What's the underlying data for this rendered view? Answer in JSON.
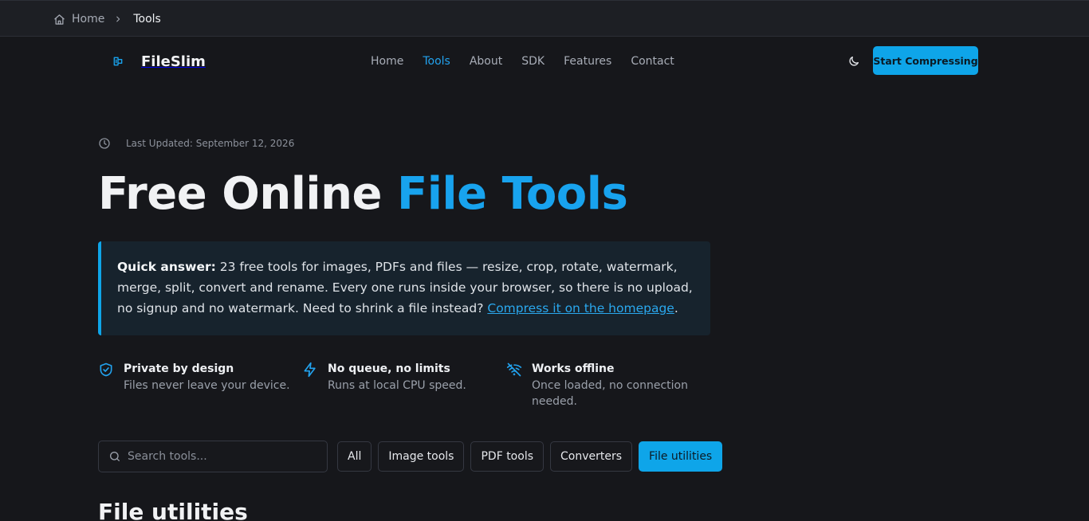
{
  "breadcrumb": {
    "home": "Home",
    "current": "Tools"
  },
  "brand": {
    "name": "FileSlim",
    "accent": "#0ea5e9"
  },
  "nav": {
    "items": [
      {
        "label": "Home"
      },
      {
        "label": "Tools",
        "active": true
      },
      {
        "label": "About"
      },
      {
        "label": "SDK"
      },
      {
        "label": "Features"
      },
      {
        "label": "Contact"
      }
    ],
    "cta": "Start Compressing"
  },
  "page": {
    "updated": "Last Updated: September 12, 2026",
    "title_main": "Free Online ",
    "title_accent": "File Tools",
    "answer": {
      "lead": "Quick answer:",
      "text": " 23 free tools for images, PDFs and files — resize, crop, rotate, watermark, merge, split, convert and rename. Every one runs inside your browser, so there is no upload, no signup and no watermark. Need to shrink a file instead? ",
      "link": "Compress it on the homepage",
      "tail": "."
    },
    "features": [
      {
        "icon": "shield-check-icon",
        "title": "Private by design",
        "desc": "Files never leave your device."
      },
      {
        "icon": "lightning-icon",
        "title": "No queue, no limits",
        "desc": "Runs at local CPU speed."
      },
      {
        "icon": "wifi-off-icon",
        "title": "Works offline",
        "desc": "Once loaded, no connection needed."
      }
    ],
    "search_placeholder": "Search tools...",
    "filters": [
      {
        "label": "All"
      },
      {
        "label": "Image tools"
      },
      {
        "label": "PDF tools"
      },
      {
        "label": "Converters"
      },
      {
        "label": "File utilities",
        "active": true
      }
    ],
    "section_title": "File utilities"
  }
}
